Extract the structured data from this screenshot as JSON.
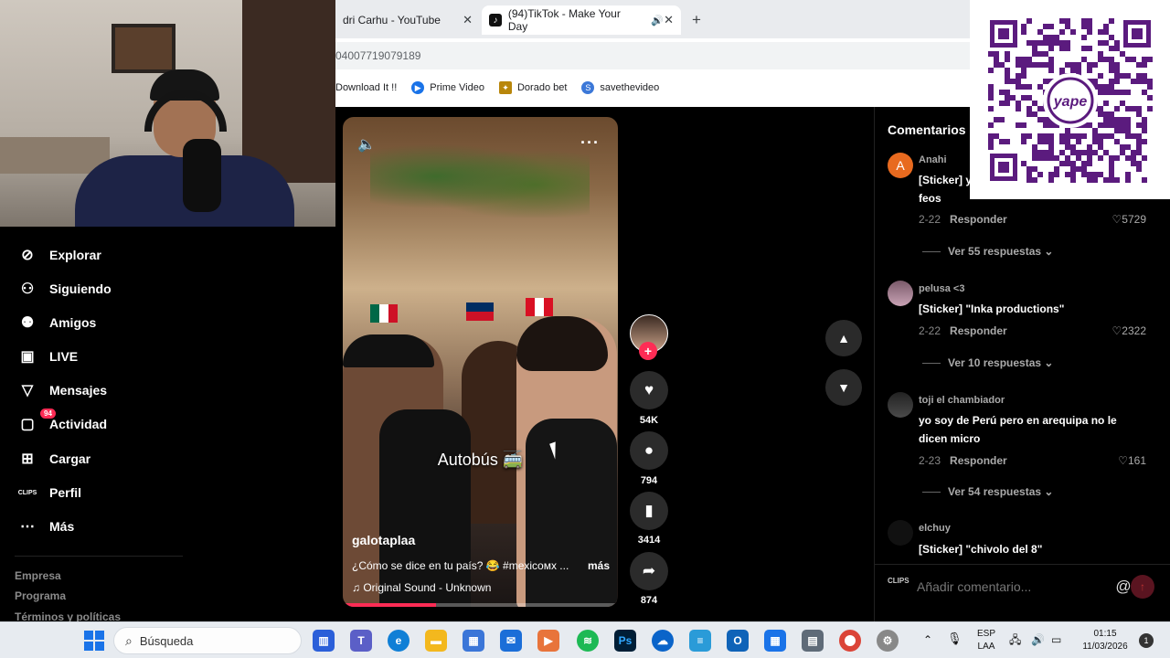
{
  "browser": {
    "tabs": [
      {
        "label": "dri Carhu - YouTube"
      },
      {
        "label": "(94)TikTok - Make Your Day"
      }
    ],
    "new_tab_symbol": "+",
    "close_symbol": "✕",
    "url": "04007719079189",
    "bookmarks": [
      {
        "label": "Download It !!"
      },
      {
        "label": "Prime Video"
      },
      {
        "label": "Dorado bet"
      },
      {
        "label": "savethevideo"
      }
    ]
  },
  "nav": {
    "items": [
      {
        "label": "Explorar",
        "icon": "compass-icon"
      },
      {
        "label": "Siguiendo",
        "icon": "user-follow-icon"
      },
      {
        "label": "Amigos",
        "icon": "friends-icon"
      },
      {
        "label": "LIVE",
        "icon": "live-tv-icon"
      },
      {
        "label": "Mensajes",
        "icon": "send-icon"
      },
      {
        "label": "Actividad",
        "icon": "inbox-icon"
      },
      {
        "label": "Cargar",
        "icon": "upload-icon"
      },
      {
        "label": "Perfil",
        "icon": "clips-icon"
      },
      {
        "label": "Más",
        "icon": "more-icon"
      }
    ],
    "activity_badge": "94",
    "clips_label": "CLIPS",
    "footer": [
      "Empresa",
      "Programa",
      "Términos y políticas"
    ]
  },
  "video": {
    "caption": "Autobús 🚎",
    "author": "galotaplaa",
    "description": "¿Cómo se dice en tu país? 😂 #mexicoмх ...",
    "more_label": "más",
    "sound": "♫  Original Sound - Unknown",
    "progress": 0.34
  },
  "actions": {
    "likes": "54K",
    "comments": "794",
    "saves": "3414",
    "shares": "874"
  },
  "comments": {
    "header": "Comentarios",
    "reply_label": "Responder",
    "items": [
      {
        "avatar_letter": "A",
        "user": "Anahi",
        "text": "[Sticker] y\nfeos",
        "date": "2-22",
        "likes": "5729",
        "more": "Ver 55 respuestas ⌄"
      },
      {
        "avatar_letter": "",
        "user": "pelusa <3",
        "text": "[Sticker] \"Inka productions\"",
        "date": "2-22",
        "likes": "2322",
        "more": "Ver 10 respuestas ⌄"
      },
      {
        "avatar_letter": "",
        "user": "toji el chambiador",
        "text": "yo soy de Perú pero en arequipa no le\ndicen micro",
        "date": "2-23",
        "likes": "161",
        "more": "Ver 54 respuestas ⌄"
      },
      {
        "avatar_letter": "",
        "user": "elchuy",
        "text": "[Sticker] \"chivolo del 8\""
      }
    ],
    "input_placeholder": "Añadir comentario...",
    "at_symbol": "@",
    "emoji_symbol": "☺",
    "clips_label": "CLIPS"
  },
  "taskbar": {
    "search_label": "Búsqueda",
    "lang_top": "ESP",
    "lang_bottom": "LAA",
    "time": "01:15",
    "date": "11/03/2026",
    "notification_count": "1"
  }
}
